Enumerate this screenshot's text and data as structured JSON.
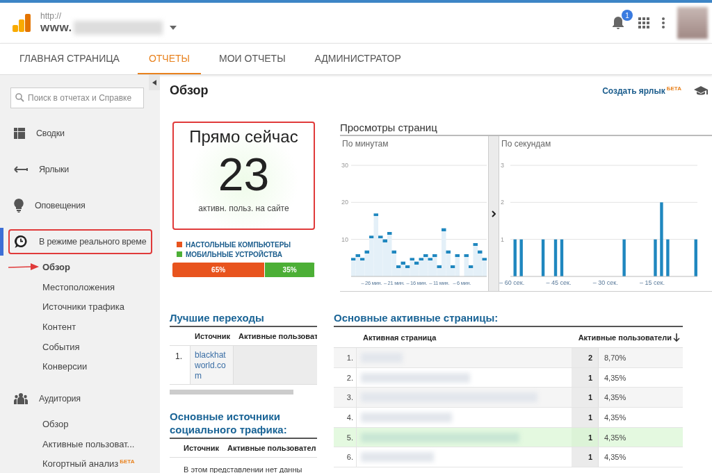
{
  "header": {
    "url_protocol": "http://",
    "url_host": "www.",
    "notifications": "1"
  },
  "nav_tabs": [
    {
      "label": "ГЛАВНАЯ СТРАНИЦА",
      "selected": false
    },
    {
      "label": "ОТЧЕТЫ",
      "selected": true
    },
    {
      "label": "МОИ ОТЧЕТЫ",
      "selected": false
    },
    {
      "label": "АДМИНИСТРАТОР",
      "selected": false
    }
  ],
  "sidebar": {
    "search": {
      "placeholder": "Поиск в отчетах и Справке"
    },
    "sections": [
      {
        "label": "Сводки",
        "selected": false,
        "annotated": false
      },
      {
        "label": "Ярлыки",
        "selected": false,
        "annotated": false
      },
      {
        "label": "Оповещения",
        "selected": false,
        "annotated": false
      },
      {
        "label": "В режиме реального време",
        "selected": true,
        "annotated": true,
        "children": [
          {
            "label": "Обзор",
            "selected": true,
            "annotated": true
          },
          {
            "label": "Местоположения",
            "selected": false,
            "annotated": false
          },
          {
            "label": "Источники трафика",
            "selected": false,
            "annotated": false
          },
          {
            "label": "Контент",
            "selected": false,
            "annotated": false
          },
          {
            "label": "События",
            "selected": false,
            "annotated": false
          },
          {
            "label": "Конверсии",
            "selected": false,
            "annotated": false
          }
        ]
      },
      {
        "label": "Аудитория",
        "selected": false,
        "annotated": false,
        "children": [
          {
            "label": "Обзор",
            "selected": false,
            "annotated": false
          },
          {
            "label": "Активные пользоват...",
            "selected": false,
            "annotated": false
          },
          {
            "label": "Когортный анализ",
            "badge": "БЕТА",
            "selected": false,
            "annotated": false
          }
        ]
      }
    ]
  },
  "main": {
    "title": "Обзор",
    "create_shortcut": {
      "label": "Создать ярлык",
      "badge": "БЕТА"
    },
    "right_now": {
      "title": "Прямо сейчас",
      "count": "23",
      "caption": "активн. польз. на сайте",
      "annotated": true,
      "devices": [
        {
          "label": "НАСТОЛЬНЫЕ КОМПЬЮТЕРЫ",
          "color": "#e8541e",
          "level": 0.65,
          "share": "65%"
        },
        {
          "label": "МОБИЛЬНЫЕ УСТРОЙСТВА",
          "color": "#4caf36",
          "level": 0.35,
          "share": "35%"
        }
      ]
    },
    "pageviews": {
      "title": "Просмотры страниц",
      "panels": [
        {
          "label": "По минутам",
          "chart_data": {
            "type": "bar",
            "x": [
              -30,
              -29,
              -28,
              -27,
              -26,
              -25,
              -24,
              -23,
              -22,
              -21,
              -20,
              -19,
              -18,
              -17,
              -16,
              -15,
              -14,
              -13,
              -12,
              -11,
              -10,
              -9,
              -8,
              -7,
              -6,
              -5,
              -4,
              -3,
              -2,
              -1
            ],
            "values": [
              5,
              6,
              5,
              7,
              11,
              17,
              11,
              10,
              12,
              7,
              3,
              4,
              3,
              5,
              4,
              5,
              6,
              5,
              6,
              3,
              13,
              7,
              3,
              6,
              0,
              6,
              3,
              9,
              7,
              5
            ],
            "xlim": [
              -30.5,
              -0.5
            ],
            "ylim": [
              0,
              30
            ],
            "yticks": [
              10,
              20,
              30
            ],
            "xticks": [
              {
                "value": -26,
                "label": "– 26 мин."
              },
              {
                "value": -21,
                "label": "– 21 мин."
              },
              {
                "value": -16,
                "label": "– 16 мин."
              },
              {
                "value": -11,
                "label": "– 11 мин."
              },
              {
                "value": -6,
                "label": "– 6 мин."
              }
            ]
          }
        },
        {
          "label": "По секундам",
          "chart_data": {
            "type": "bar",
            "x": [
              -59,
              -57,
              -50,
              -46,
              -44,
              -24,
              -14,
              -12,
              -10,
              -1
            ],
            "values": [
              1,
              1,
              1,
              1,
              1,
              1,
              1,
              2,
              1,
              1
            ],
            "xlim": [
              -60.5,
              -0.5
            ],
            "ylim": [
              0,
              3
            ],
            "yticks": [
              1,
              2,
              3
            ],
            "xticks": [
              {
                "value": -60,
                "label": "– 60 сек."
              },
              {
                "value": -45,
                "label": "– 45 сек."
              },
              {
                "value": -30,
                "label": "– 30 сек."
              },
              {
                "value": -15,
                "label": "– 15 сек."
              }
            ]
          }
        }
      ]
    },
    "top_referrals": {
      "title": "Лучшие переходы",
      "columns": [
        "Источник",
        "Активные пользоват"
      ],
      "rows": [
        {
          "rank": "1.",
          "source": "blackhatworld.com"
        }
      ]
    },
    "social_sources": {
      "title": "Основные источники социального трафика:",
      "columns": [
        "Источник",
        "Активные пользовател"
      ],
      "empty_message": "В этом представлении нет данны"
    },
    "active_pages": {
      "title": "Основные активные страницы:",
      "columns": [
        "Активная страница",
        "Активные пользователи"
      ],
      "rows": [
        {
          "rank": "1.",
          "users": "2",
          "percent": "8,70%",
          "highlighted": false
        },
        {
          "rank": "2.",
          "users": "1",
          "percent": "4,35%",
          "highlighted": false
        },
        {
          "rank": "3.",
          "users": "1",
          "percent": "4,35%",
          "highlighted": false
        },
        {
          "rank": "4.",
          "users": "1",
          "percent": "4,35%",
          "highlighted": false
        },
        {
          "rank": "5.",
          "users": "1",
          "percent": "4,35%",
          "highlighted": true
        },
        {
          "rank": "6.",
          "users": "1",
          "percent": "4,35%",
          "highlighted": false
        }
      ]
    }
  }
}
